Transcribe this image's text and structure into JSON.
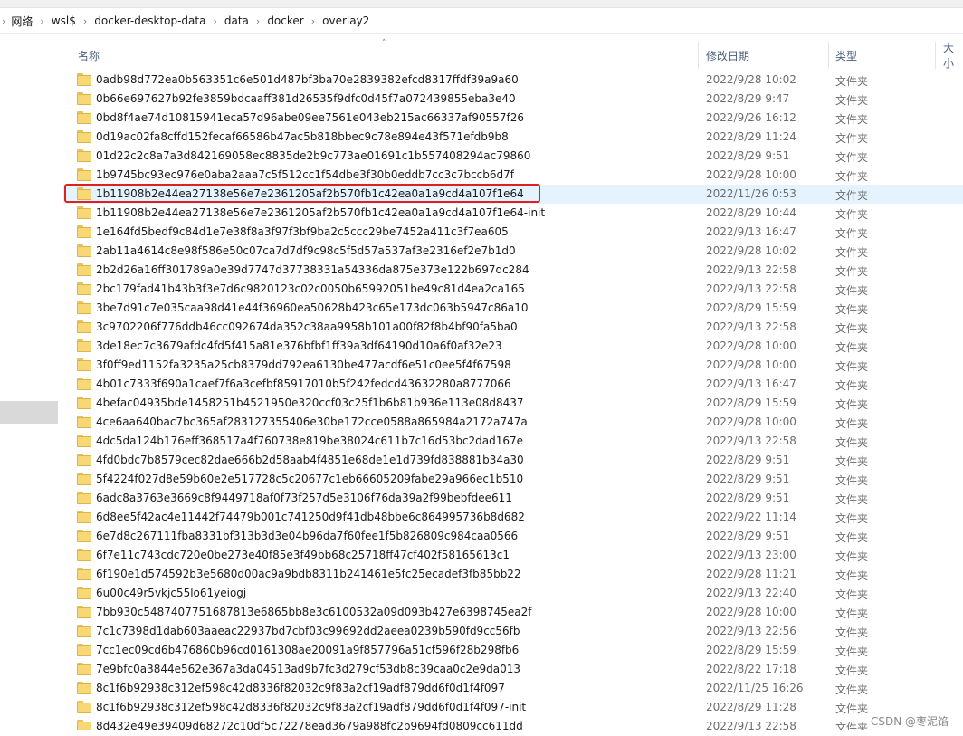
{
  "breadcrumb": [
    "网络",
    "wsl$",
    "docker-desktop-data",
    "data",
    "docker",
    "overlay2"
  ],
  "columns": {
    "name": "名称",
    "date": "修改日期",
    "type": "类型",
    "size": "大小"
  },
  "folder_type": "文件夹",
  "selected_index": 6,
  "rows": [
    {
      "name": "0adb98d772ea0b563351c6e501d487bf3ba70e2839382efcd8317ffdf39a9a60",
      "date": "2022/9/28 10:02"
    },
    {
      "name": "0b66e697627b92fe3859bdcaaff381d26535f9dfc0d45f7a072439855eba3e40",
      "date": "2022/8/29 9:47"
    },
    {
      "name": "0bd8f4ae74d10815941eca57d96abe09ee7561e043eb215ac66337af90557f26",
      "date": "2022/9/26 16:12"
    },
    {
      "name": "0d19ac02fa8cffd152fecaf66586b47ac5b818bbec9c78e894e43f571efdb9b8",
      "date": "2022/8/29 11:24"
    },
    {
      "name": "01d22c2c8a7a3d842169058ec8835de2b9c773ae01691c1b557408294ac79860",
      "date": "2022/8/29 9:51"
    },
    {
      "name": "1b9745bc93ec976e0aba2aaa7c5f512cc1f54dbe3f30b0eddb7cc3c7bccb6d7f",
      "date": "2022/9/28 10:00"
    },
    {
      "name": "1b11908b2e44ea27138e56e7e2361205af2b570fb1c42ea0a1a9cd4a107f1e64",
      "date": "2022/11/26 0:53"
    },
    {
      "name": "1b11908b2e44ea27138e56e7e2361205af2b570fb1c42ea0a1a9cd4a107f1e64-init",
      "date": "2022/8/29 10:44"
    },
    {
      "name": "1e164fd5bedf9c84d1e7e38f8a3f97f3bf9ba2c5ccc29be7452a411c3f7ea605",
      "date": "2022/9/13 16:47"
    },
    {
      "name": "2ab11a4614c8e98f586e50c07ca7d7df9c98c5f5d57a537af3e2316ef2e7b1d0",
      "date": "2022/9/28 10:02"
    },
    {
      "name": "2b2d26a16ff301789a0e39d7747d37738331a54336da875e373e122b697dc284",
      "date": "2022/9/13 22:58"
    },
    {
      "name": "2bc179fad41b43b3f3e7d6c9820123c02c0050b65992051be49c81d4ea2ca165",
      "date": "2022/9/13 22:58"
    },
    {
      "name": "3be7d91c7e035caa98d41e44f36960ea50628b423c65e173dc063b5947c86a10",
      "date": "2022/8/29 15:59"
    },
    {
      "name": "3c9702206f776ddb46cc092674da352c38aa9958b101a00f82f8b4bf90fa5ba0",
      "date": "2022/9/13 22:58"
    },
    {
      "name": "3de18ec7c3679afdc4fd5f415a81e376bfbf1ff39a3df64190d10a6f0af32e23",
      "date": "2022/9/28 10:00"
    },
    {
      "name": "3f0ff9ed1152fa3235a25cb8379dd792ea6130be477acdf6e51c0ee5f4f67598",
      "date": "2022/9/28 10:00"
    },
    {
      "name": "4b01c7333f690a1caef7f6a3cefbf85917010b5f242fedcd43632280a8777066",
      "date": "2022/9/13 16:47"
    },
    {
      "name": "4befac04935bde1458251b4521950e320ccf03c25f1b6b81b936e113e08d8437",
      "date": "2022/8/29 15:59"
    },
    {
      "name": "4ce6aa640bac7bc365af283127355406e30be172cce0588a865984a2172a747a",
      "date": "2022/9/28 10:00"
    },
    {
      "name": "4dc5da124b176eff368517a4f760738e819be38024c611b7c16d53bc2dad167e",
      "date": "2022/9/13 22:58"
    },
    {
      "name": "4fd0bdc7b8579cec82dae666b2d58aab4f4851e68de1e1d739fd838881b34a30",
      "date": "2022/8/29 9:51"
    },
    {
      "name": "5f4224f027d8e59b60e2e517728c5c20677c1eb66605209fabe29a966ec1b510",
      "date": "2022/8/29 9:51"
    },
    {
      "name": "6adc8a3763e3669c8f9449718af0f73f257d5e3106f76da39a2f99bebfdee611",
      "date": "2022/8/29 9:51"
    },
    {
      "name": "6d8ee5f42ac4e11442f74479b001c741250d9f41db48bbe6c864995736b8d682",
      "date": "2022/9/22 11:14"
    },
    {
      "name": "6e7d8c267111fba8331bf313b3d3e04b96da7f60fee1f5b826809c984caa0566",
      "date": "2022/8/29 9:51"
    },
    {
      "name": "6f7e11c743cdc720e0be273e40f85e3f49bb68c25718ff47cf402f58165613c1",
      "date": "2022/9/13 23:00"
    },
    {
      "name": "6f190e1d574592b3e5680d00ac9a9bdb8311b241461e5fc25ecadef3fb85bb22",
      "date": "2022/9/28 11:21"
    },
    {
      "name": "6u00c49r5vkjc55lo61yeiogj",
      "date": "2022/9/13 22:40"
    },
    {
      "name": "7bb930c5487407751687813e6865bb8e3c6100532a09d093b427e6398745ea2f",
      "date": "2022/9/28 10:00"
    },
    {
      "name": "7c1c7398d1dab603aaeac22937bd7cbf03c99692dd2aeea0239b590fd9cc56fb",
      "date": "2022/9/13 22:56"
    },
    {
      "name": "7cc1ec09cd6b476860b96cd0161308ae20091a9f857796a51cf596f28b298fb6",
      "date": "2022/8/29 15:59"
    },
    {
      "name": "7e9bfc0a3844e562e367a3da04513ad9b7fc3d279cf53db8c39caa0c2e9da013",
      "date": "2022/8/22 17:18"
    },
    {
      "name": "8c1f6b92938c312ef598c42d8336f82032c9f83a2cf19adf879dd6f0d1f4f097",
      "date": "2022/11/25 16:26"
    },
    {
      "name": "8c1f6b92938c312ef598c42d8336f82032c9f83a2cf19adf879dd6f0d1f4f097-init",
      "date": "2022/8/29 11:28"
    },
    {
      "name": "8d432e49e39409d68272c10df5c72278ead3679a988fc2b9694fd0809cc611dd",
      "date": "2022/9/13 22:58"
    }
  ],
  "watermark": "CSDN @枣泥馅"
}
